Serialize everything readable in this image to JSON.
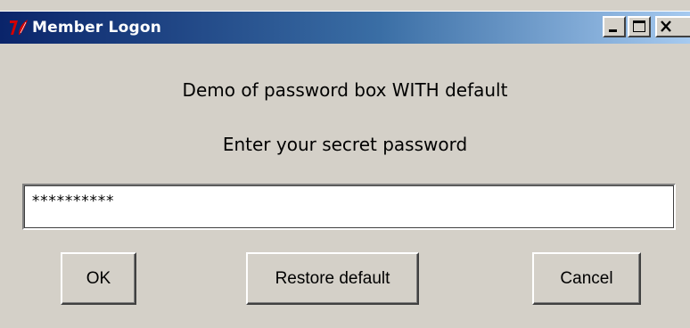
{
  "window": {
    "title": "Member Logon",
    "controls": {
      "minimize_icon": "minimize-icon",
      "maximize_icon": "maximize-icon",
      "close_icon": "close-icon"
    }
  },
  "content": {
    "heading": "Demo of password box WITH default",
    "prompt": "Enter your secret password"
  },
  "password_field": {
    "value": "**********"
  },
  "buttons": {
    "ok": "OK",
    "restore_default": "Restore default",
    "cancel": "Cancel"
  },
  "colors": {
    "titlebar_start": "#0a246a",
    "titlebar_end": "#a6caf0",
    "dialog_bg": "#d4d0c8"
  }
}
